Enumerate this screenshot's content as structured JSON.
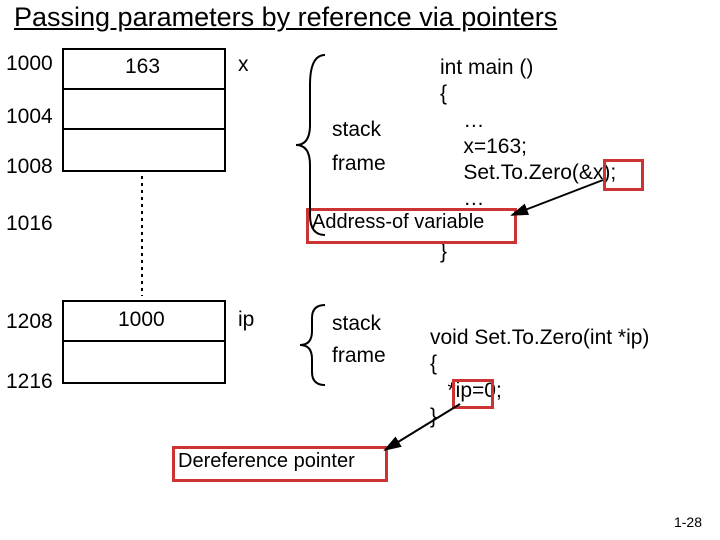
{
  "title": "Passing parameters by reference via pointers",
  "addresses": {
    "a1000": "1000",
    "a1004": "1004",
    "a1008": "1008",
    "a1016": "1016",
    "a1208": "1208",
    "a1216": "1216"
  },
  "cells": {
    "val_x": "163",
    "val_ip": "1000"
  },
  "varlabels": {
    "x": "x",
    "ip": "ip"
  },
  "sflabels": {
    "stack1": "stack",
    "frame1": "frame",
    "stack2": "stack",
    "frame2": "frame"
  },
  "code": {
    "main": "int main ()\n{\n    …\n    x=163;\n    Set.To.Zero(&x);\n    …\n    …\n}",
    "fn": "void Set.To.Zero(int *ip)\n{\n   *ip=0;\n}"
  },
  "annotations": {
    "addrof": "Address-of variable",
    "deref": "Dereference pointer"
  },
  "pagenum": "1-28"
}
